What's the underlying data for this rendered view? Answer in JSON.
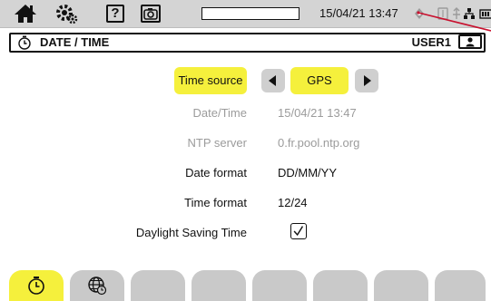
{
  "status_bar": {
    "icons": [
      "home-icon",
      "settings-icon",
      "help-icon",
      "camera-icon",
      "gps-icon",
      "usb-icon",
      "network-icon",
      "battery-icon"
    ],
    "help_label": "?",
    "progress_level": 0,
    "datetime": "15/04/21 13:47"
  },
  "title_bar": {
    "icon": "clock-icon",
    "title": "DATE / TIME",
    "user": "USER1",
    "user_icon": "user-icon"
  },
  "form": {
    "time_source": {
      "label": "Time source",
      "value": "GPS"
    },
    "datetime": {
      "label": "Date/Time",
      "value": "15/04/21 13:47"
    },
    "ntp_server": {
      "label": "NTP server",
      "value": "0.fr.pool.ntp.org"
    },
    "date_format": {
      "label": "Date format",
      "value": "DD/MM/YY"
    },
    "time_format": {
      "label": "Time format",
      "value": "12/24"
    },
    "dst": {
      "label": "Daylight Saving Time",
      "checked": true
    }
  },
  "tabs": [
    {
      "icon": "clock-icon",
      "active": true
    },
    {
      "icon": "globe-clock-icon",
      "active": false
    },
    {
      "icon": "",
      "active": false
    },
    {
      "icon": "",
      "active": false
    },
    {
      "icon": "",
      "active": false
    },
    {
      "icon": "",
      "active": false
    },
    {
      "icon": "",
      "active": false
    },
    {
      "icon": "",
      "active": false
    }
  ],
  "colors": {
    "accent_yellow": "#f5f03c",
    "tab_gray": "#c9c9c9",
    "status_bg": "#d4d4d4",
    "annotation_red": "#c8102e"
  }
}
